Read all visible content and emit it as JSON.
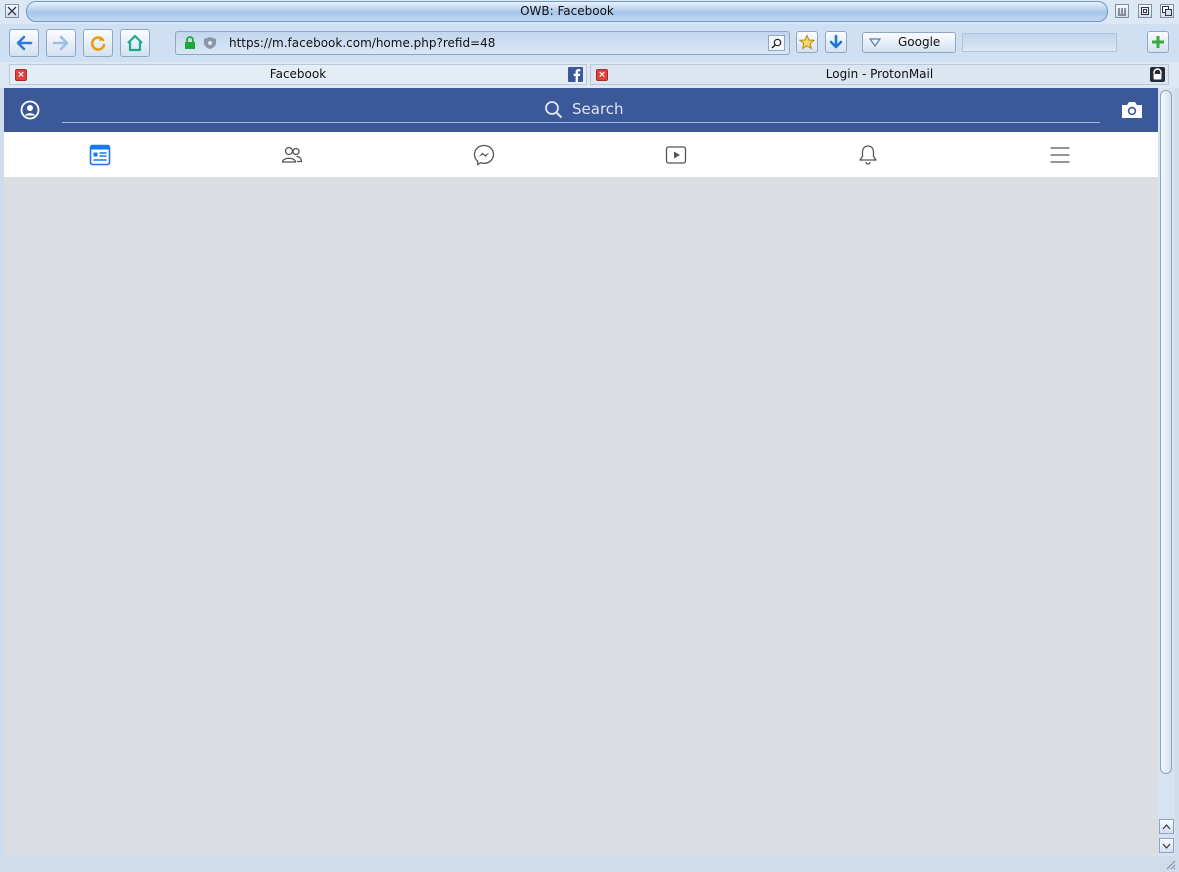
{
  "window": {
    "title": "OWB: Facebook"
  },
  "toolbar": {
    "url": "https://m.facebook.com/home.php?refid=48",
    "search_engine": "Google",
    "search_value": ""
  },
  "tabs": [
    {
      "label": "Facebook",
      "active": true
    },
    {
      "label": "Login - ProtonMail",
      "active": false
    }
  ],
  "page": {
    "search_placeholder": "Search",
    "nav_items": [
      "news-feed",
      "friends",
      "messenger",
      "watch",
      "notifications",
      "menu"
    ]
  },
  "colors": {
    "facebook_blue": "#3b5998",
    "active_nav": "#1877f2",
    "page_background": "#dadde1"
  }
}
